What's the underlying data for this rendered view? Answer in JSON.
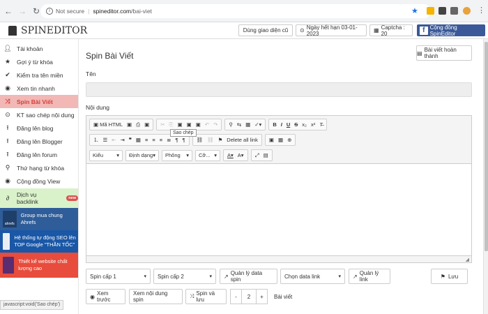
{
  "browser": {
    "security": "Not secure",
    "domain": "spineditor.com",
    "path": "/bai-viet",
    "status_url": "javascript:void('Sao chép')"
  },
  "header": {
    "logo": "SPINEDITOR",
    "theme_button": "Dùng giao diện cũ",
    "expiry": "Ngày hết hạn 03-01-2023",
    "captcha": "Captcha : 20",
    "community": "Cộng đồng SpinEditor"
  },
  "sidebar": {
    "items": [
      {
        "label": "Tài khoản",
        "icon": "user-icon"
      },
      {
        "label": "Gợi ý từ khóa",
        "icon": "star-icon"
      },
      {
        "label": "Kiểm tra tên miền",
        "icon": "check-icon"
      },
      {
        "label": "Xem tin nhanh",
        "icon": "eye-icon"
      },
      {
        "label": "Spin Bài Viết",
        "icon": "shuffle-icon"
      },
      {
        "label": "KT sao chép nội dung",
        "icon": "copy-check-icon"
      },
      {
        "label": "Đăng lên blog",
        "icon": "upload-icon"
      },
      {
        "label": "Đăng lên Blogger",
        "icon": "upload-icon"
      },
      {
        "label": "Đăng lên forum",
        "icon": "upload-icon"
      },
      {
        "label": "Thứ hạng từ khóa",
        "icon": "search-icon"
      },
      {
        "label": "Cộng đồng View",
        "icon": "eye-icon"
      }
    ],
    "backlink": {
      "label": "Dịch vụ backlink",
      "badge": "new"
    },
    "promos": [
      {
        "label": "Group mua chung Ahrefs",
        "thumb_text": "ahrefs"
      },
      {
        "label": "Hệ thống tự động SEO lên TOP Google \"THẦN TỐC\""
      },
      {
        "label": "Thiết kế website chất lượng cao"
      }
    ]
  },
  "main": {
    "title": "Spin Bài Viết",
    "done_button": "Bài viết hoàn thành",
    "name_label": "Tên",
    "name_value": "",
    "content_label": "Nội dung",
    "editor": {
      "source_button": "Mã HTML",
      "tooltip": "Sao chép",
      "delete_links": "Delete all link",
      "styles_combo": "Kiểu",
      "format_combo": "Định dạng",
      "font_combo": "Phông",
      "size_combo": "Cỡ...",
      "content": ""
    },
    "controls": {
      "spin_level_1": "Spin cấp 1",
      "spin_level_2": "Spin cấp 2",
      "manage_data_spin": "Quản lý data spin",
      "choose_data_link": "Chọn data link",
      "manage_link": "Quản lý link",
      "save": "Lưu",
      "preview": "Xem trước",
      "view_spin_content": "Xem nội dung spin",
      "spin_and_save": "Spin và lưu",
      "minus": "-",
      "count": "2",
      "plus": "+",
      "count_unit": "Bài viết"
    }
  }
}
